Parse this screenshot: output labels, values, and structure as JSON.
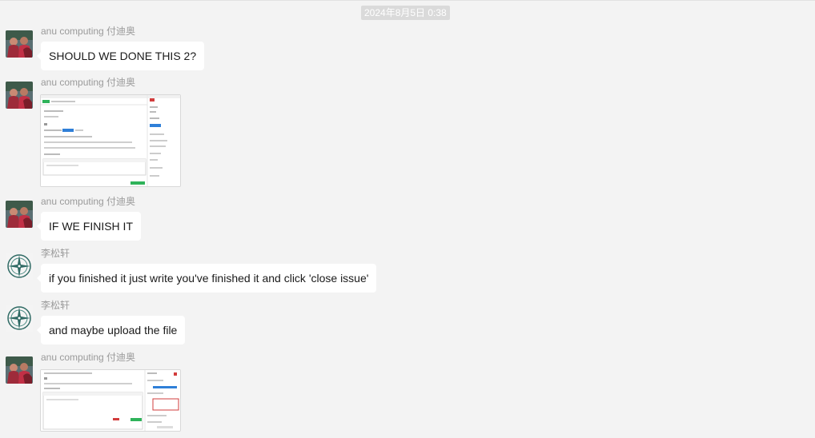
{
  "header": {
    "timestamp": "2024年8月5日 0:38"
  },
  "messages": [
    {
      "sender": "anu computing 付迪奥",
      "avatar": "photo-avatar",
      "type": "text",
      "text": "SHOULD WE DONE THIS 2?"
    },
    {
      "sender": "anu computing 付迪奥",
      "avatar": "photo-avatar",
      "type": "image",
      "image": "screenshot-thumbnail"
    },
    {
      "sender": "anu computing 付迪奥",
      "avatar": "photo-avatar",
      "type": "text",
      "text": "IF WE FINISH IT"
    },
    {
      "sender": "李松轩",
      "avatar": "compass-avatar",
      "type": "text",
      "text": "if you finished it just write you've finished it and click 'close issue'"
    },
    {
      "sender": "李松轩",
      "avatar": "compass-avatar",
      "type": "text",
      "text": "and maybe upload the file"
    },
    {
      "sender": "anu computing 付迪奥",
      "avatar": "photo-avatar",
      "type": "image",
      "image": "screenshot-thumbnail"
    }
  ],
  "colors": {
    "background": "#f3f3f3",
    "bubble": "#ffffff",
    "sender_text": "#9a9a9a",
    "timestamp_bg": "#dadada",
    "accent_green": "#2fb35a",
    "accent_blue": "#2f7fd8",
    "accent_red": "#d23c3c"
  }
}
